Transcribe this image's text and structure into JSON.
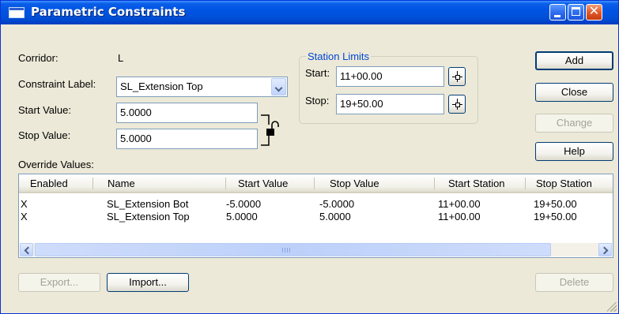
{
  "window": {
    "title": "Parametric Constraints"
  },
  "form": {
    "corridor_label": "Corridor:",
    "corridor_value": "L",
    "constraint_label_label": "Constraint Label:",
    "constraint_label_value": "SL_Extension Top",
    "start_value_label": "Start Value:",
    "start_value": "5.0000",
    "stop_value_label": "Stop Value:",
    "stop_value": "5.0000",
    "override_values_label": "Override Values:"
  },
  "station_limits": {
    "title": "Station Limits",
    "start_label": "Start:",
    "start_value": "11+00.00",
    "stop_label": "Stop:",
    "stop_value": "19+50.00"
  },
  "buttons": {
    "add": "Add",
    "close": "Close",
    "change": "Change",
    "help": "Help",
    "export": "Export...",
    "import": "Import...",
    "delete": "Delete"
  },
  "table": {
    "columns": [
      "Enabled",
      "Name",
      "Start Value",
      "Stop Value",
      "Start Station",
      "Stop Station"
    ],
    "rows": [
      [
        "X",
        "SL_Extension Bot",
        "-5.0000",
        "-5.0000",
        "11+00.00",
        "19+50.00"
      ],
      [
        "X",
        "SL_Extension Top",
        "5.0000",
        "5.0000",
        "11+00.00",
        "19+50.00"
      ]
    ]
  },
  "colors": {
    "title_bar": "#0054e3",
    "dialog_bg": "#ece9d8",
    "group_title": "#0046d5"
  }
}
